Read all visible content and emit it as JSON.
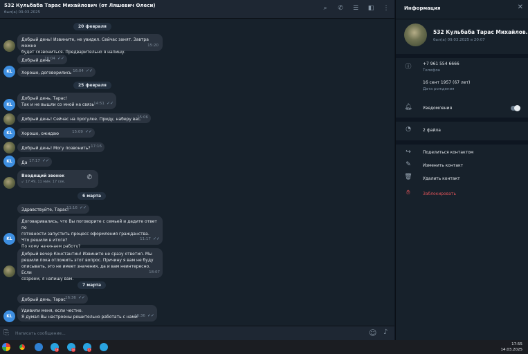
{
  "chat": {
    "title": "532 Кульбаба Тарас Михайлович (от Ляшевич Олеси)",
    "status": "был(а) 09.03.2025",
    "header_icons": [
      "search-icon",
      "phone-icon",
      "sliders-icon",
      "sidebar-icon",
      "more-icon"
    ]
  },
  "messages": {
    "dates": [
      "20 февраля",
      "25 февраля",
      "6 марта",
      "7 марта"
    ],
    "items": [
      {
        "lines": [
          "Добрый день! Извините, не увидел. Сейчас занят. Завтра можно",
          "будет созвониться. Предварительно я напишу."
        ],
        "time": "15:20",
        "ticks": ""
      },
      {
        "lines": [
          "Добрый день"
        ],
        "time": "16:04",
        "ticks": "✓✓"
      },
      {
        "lines": [
          "Хорошо, договорились"
        ],
        "time": "16:04",
        "ticks": "✓✓"
      },
      {
        "lines": [
          "Добрый день, Тарас!",
          "Так и не вышли со мной на связь"
        ],
        "time": "14:51",
        "ticks": "✓✓"
      },
      {
        "lines": [
          "Добрый день! Сейчас на прогулке. Приду, наберу вас."
        ],
        "time": "15:06",
        "ticks": ""
      },
      {
        "lines": [
          "Хорошо, ожидаю"
        ],
        "time": "15:09",
        "ticks": "✓✓"
      },
      {
        "lines": [
          "Добрый день! Могу позвонить?"
        ],
        "time": "17:16",
        "ticks": ""
      },
      {
        "lines": [
          "Да"
        ],
        "time": "17:17",
        "ticks": "✓✓"
      },
      {
        "lines": [
          "Здравствуйте, Тарас!"
        ],
        "time": "11:16",
        "ticks": "✓✓"
      },
      {
        "lines": [
          "Договаривались, что Вы поговорите с семьей и дадите ответ по",
          "готовности запустить процесс оформления гражданства.",
          "Что решили в итоге?",
          "По кому начинаем работу?"
        ],
        "time": "11:17",
        "ticks": "✓✓"
      },
      {
        "lines": [
          "Добрый вечер Константин! Извините не сразу ответил. Мы",
          "решили пока отложить этот вопрос. Причину я вам не буду",
          "описывать, это не имеет значения, да и вам неинтересно. Если",
          "созреем, я напишу вам."
        ],
        "time": "18:07",
        "ticks": ""
      },
      {
        "lines": [
          "Добрый день, Тарас"
        ],
        "time": "16:36",
        "ticks": "✓✓"
      },
      {
        "lines": [
          "Удивили меня, если честно.",
          "Я думал Вы настроены решительно работать с нами"
        ],
        "time": "16:36",
        "ticks": "✓✓"
      }
    ],
    "call": {
      "title": "Входящий звонок",
      "detail": "↙ 17:49, 11 мин. 17 сек."
    },
    "avatar_initials": "KL"
  },
  "composer": {
    "placeholder": "Написать сообщение..."
  },
  "info": {
    "title": "Информация",
    "name": "532 Кульбаба Тарас Михайлов...",
    "seen": "был(а) 09.03.2025 в 20:07",
    "phone": "+7 961 554 6666",
    "phone_label": "Телефон",
    "birthday": "16 сент 1957 (67 лет)",
    "birthday_label": "Дата рождения",
    "notifications": "Уведомления",
    "files": "2 файла",
    "share": "Поделиться контактом",
    "edit": "Изменить контакт",
    "delete": "Удалить контакт",
    "block": "Заблокировать"
  },
  "taskbar": {
    "time": "17:55",
    "date": "14.03.2025",
    "badges": [
      "18",
      "10",
      "17"
    ]
  },
  "colors": {
    "accent": "#3d8ee0",
    "danger": "#e05459",
    "bubble": "#2b3440",
    "background": "#17212b"
  }
}
